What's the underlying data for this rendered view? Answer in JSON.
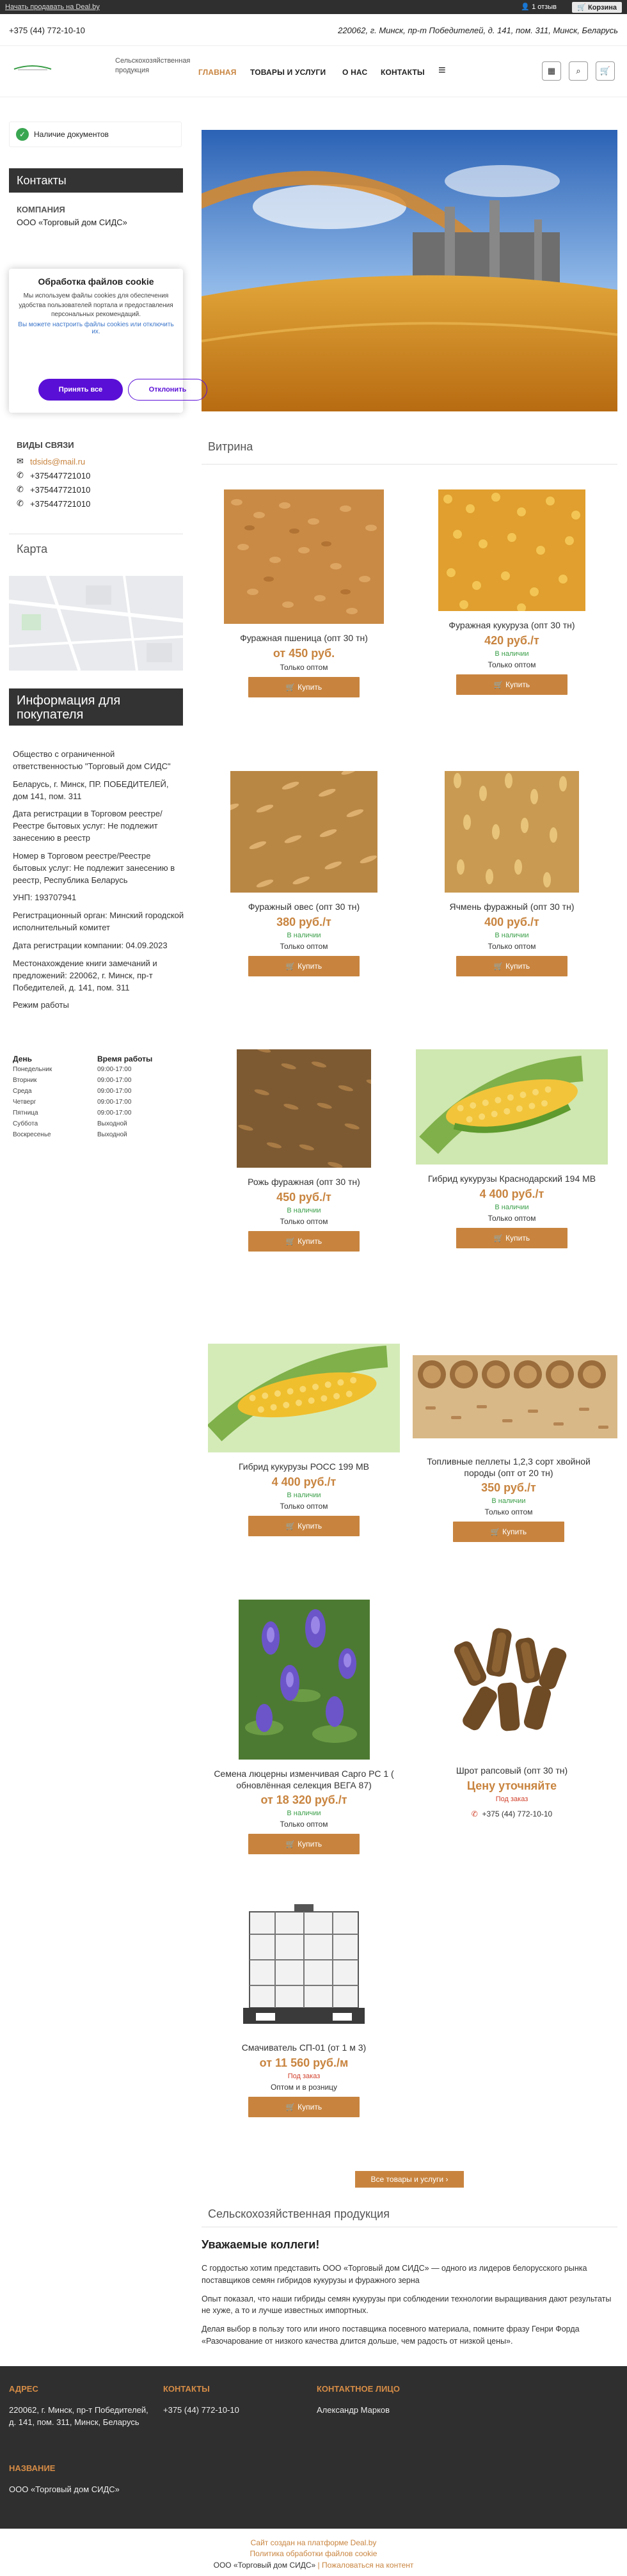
{
  "topbar": {
    "start_link": "Начать продавать на Deal.by",
    "login": "1 отзыв",
    "cart": "Корзина"
  },
  "header": {
    "phone": "+375 (44) 772-10-10",
    "address": "220062, г. Минск, пр-т Победителей, д. 141, пом. 311, Минск, Беларусь"
  },
  "nav": {
    "company_desc": "Сельскохозяйственная продукция",
    "items": [
      "ГЛАВНАЯ",
      "ТОВАРЫ И УСЛУГИ",
      "О НАС",
      "КОНТАКТЫ"
    ],
    "menu_icon": "hamburger-icon",
    "icons": [
      "catalog-icon",
      "search-icon",
      "cart-icon"
    ]
  },
  "sidebar": {
    "docs": "Наличие документов",
    "contacts_title": "Контакты",
    "company_label": "КОМПАНИЯ",
    "company_value": "ООО «Торговый дом СИДС»",
    "contact_types_title": "ВИДЫ СВЯЗИ",
    "contacts": [
      {
        "icon": "email-icon",
        "value": "tdsids@mail.ru"
      },
      {
        "icon": "phone-icon",
        "value": "+375447721010"
      },
      {
        "icon": "viber-icon",
        "value": "+375447721010"
      },
      {
        "icon": "whatsapp-icon",
        "value": "+375447721010"
      }
    ],
    "map_title": "Карта",
    "info_title": "Информация для покупателя",
    "info_paragraphs": [
      "Общество с ограниченной ответственностью \"Торговый дом СИДС\"",
      "Беларусь, г. Минск, ПР. ПОБЕДИТЕЛЕЙ, дом 141, пом. 311",
      "Дата регистрации в Торговом реестре/Реестре бытовых услуг: Не подлежит занесению в реестр",
      "Номер в Торговом реестре/Реестре бытовых услуг: Не подлежит занесению в реестр, Республика Беларусь",
      "УНП: 193707941",
      "Регистрационный орган: Минский городской исполнительный комитет",
      "Дата регистрации компании: 04.09.2023",
      "Местонахождение книги замечаний и предложений: 220062, г. Минск, пр-т Победителей, д. 141, пом. 311",
      "Режим работы"
    ],
    "hours_header": [
      "День",
      "Время работы"
    ],
    "hours": [
      [
        "Понедельник",
        "09:00-17:00"
      ],
      [
        "Вторник",
        "09:00-17:00"
      ],
      [
        "Среда",
        "09:00-17:00"
      ],
      [
        "Четверг",
        "09:00-17:00"
      ],
      [
        "Пятница",
        "09:00-17:00"
      ],
      [
        "Суббота",
        "Выходной"
      ],
      [
        "Воскресенье",
        "Выходной"
      ]
    ]
  },
  "cookie": {
    "title": "Обработка файлов cookie",
    "text": "Мы используем файлы cookies для обеспечения удобства пользователей портала и предоставления персональных рекомендаций.",
    "settings_link": "Вы можете настроить файлы cookies или отключить их.",
    "accept": "Принять все",
    "reject": "Отклонить"
  },
  "showcase": {
    "title": "Витрина",
    "buy_label": "Купить",
    "products": [
      {
        "name": "Фуражная пшеница (опт 30 тн)",
        "price": "от 450 руб.",
        "status": "",
        "note": "Только оптом",
        "image": "wheat",
        "buy": true
      },
      {
        "name": "Фуражная кукуруза (опт 30 тн)",
        "price": "420 руб./т",
        "status": "В наличии",
        "note": "Только оптом",
        "image": "corn",
        "buy": true
      },
      {
        "name": "Фуражный овес (опт 30 тн)",
        "price": "380 руб./т",
        "status": "В наличии",
        "note": "Только оптом",
        "image": "oats",
        "buy": true
      },
      {
        "name": "Ячмень фуражный (опт 30 тн)",
        "price": "400 руб./т",
        "status": "В наличии",
        "note": "Только оптом",
        "image": "barley",
        "buy": true
      },
      {
        "name": "Рожь фуражная (опт 30 тн)",
        "price": "450 руб./т",
        "status": "В наличии",
        "note": "Только оптом",
        "image": "rye",
        "buy": true
      },
      {
        "name": "Гибрид кукурузы Краснодарский 194 МВ",
        "price": "4 400 руб./т",
        "status": "В наличии",
        "note": "Только оптом",
        "image": "corn-cob",
        "buy": true
      },
      {
        "name": "Гибрид кукурузы РОСС 199 МВ",
        "price": "4 400 руб./т",
        "status": "В наличии",
        "note": "Только оптом",
        "image": "corn-cob",
        "buy": true
      },
      {
        "name": "Топливные пеллеты 1,2,3 сорт хвойной породы (опт от 20 тн)",
        "price": "350 руб./т",
        "status": "В наличии",
        "note": "Только оптом",
        "image": "pellets",
        "buy": true
      },
      {
        "name": "Семена люцерны изменчивая Сарго РС 1 ( обновлённая селекция ВЕГА 87)",
        "price": "от 18 320 руб./т",
        "status": "В наличии",
        "note": "Только оптом",
        "image": "alfalfa",
        "buy": true
      },
      {
        "name": "Шрот рапсовый (опт 30 тн)",
        "price": "Цену уточняйте",
        "status": "Под заказ",
        "note": "",
        "image": "meal",
        "buy": false,
        "phone": "+375 (44) 772-10-10"
      },
      {
        "name": "Смачиватель СП-01 (от 1 м 3)",
        "price": "от 11 560 руб./м",
        "status": "Под заказ",
        "note": "Оптом и в розницу",
        "image": "ibc",
        "buy": true
      }
    ],
    "all_button": "Все товары и услуги"
  },
  "about": {
    "title": "Сельскохозяйственная продукция",
    "heading": "Уважаемые коллеги!",
    "paragraphs": [
      "С гордостью хотим представить ООО «Торговый дом СИДС» — одного из лидеров белорусского рынка поставщиков семян гибридов кукурузы и фуражного зерна",
      "Опыт показал, что наши гибриды семян кукурузы при соблюдении технологии выращивания дают результаты не хуже, а то и лучше известных импортных.",
      "Делая выбор в пользу того или иного поставщика посевного материала, помните фразу Генри Форда «Разочарование от низкого качества длится дольше, чем радость от низкой цены»."
    ]
  },
  "footer": {
    "address_title": "АДРЕС",
    "address": "220062, г. Минск, пр-т Победителей, д. 141, пом. 311, Минск, Беларусь",
    "contacts_title": "КОНТАКТЫ",
    "contacts": "+375 (44) 772-10-10",
    "person_title": "КОНТАКТНОЕ ЛИЦО",
    "person": "Александр Марков",
    "name_title": "НАЗВАНИЕ",
    "name": "ООО «Торговый дом СИДС»",
    "bottom_line1": "Сайт создан на платформе Deal.by",
    "bottom_line2": "Политика обработки файлов cookie",
    "bottom_company": "ООО «Торговый дом СИДС»",
    "bottom_complaint": "Пожаловаться на контент"
  },
  "colors": {
    "accent": "#c8843f",
    "dark": "#333333",
    "cookie_accept": "#5a0fd6",
    "in_stock": "#3a9e48",
    "on_order": "#d1412c"
  }
}
